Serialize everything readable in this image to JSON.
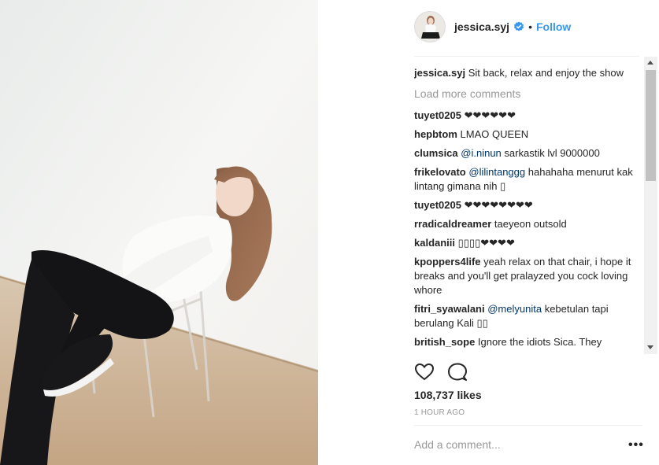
{
  "header": {
    "username": "jessica.syj",
    "separator": "•",
    "follow_label": "Follow"
  },
  "caption": {
    "user": "jessica.syj",
    "text": "Sit back, relax and enjoy the show"
  },
  "load_more": "Load more comments",
  "comments": [
    {
      "user": "tuyet0205",
      "text": "❤❤❤❤❤❤"
    },
    {
      "user": "hepbtom",
      "text": "LMAO QUEEN"
    },
    {
      "user": "clumsica",
      "mention": "@i.ninun",
      "text": "sarkastik lvl 9000000"
    },
    {
      "user": "frikelovato",
      "mention": "@lilintanggg",
      "text": "hahahaha menurut kak lintang gimana nih ▯"
    },
    {
      "user": "tuyet0205",
      "text": "❤❤❤❤❤❤❤❤"
    },
    {
      "user": "rradicaldreamer",
      "text": "taeyeon outsold"
    },
    {
      "user": "kaldaniii",
      "text": "▯▯▯▯❤❤❤❤"
    },
    {
      "user": "kpoppers4life",
      "text": "yeah relax on that chair, i hope it breaks and you'll get pralayzed you cock loving whore"
    },
    {
      "user": "fitri_syawalani",
      "mention": "@melyunita",
      "text": "kebetulan tapi berulang Kali ▯▯"
    },
    {
      "user": "british_sope",
      "text": "Ignore the idiots Sica. They"
    }
  ],
  "likes": "108,737 likes",
  "time": "1 HOUR AGO",
  "add_comment": {
    "placeholder": "Add a comment..."
  },
  "more_label": "•••",
  "icons": {
    "like": "heart-outline-icon",
    "comment": "speech-bubble-icon",
    "verified": "blue-check-badge-icon"
  },
  "colors": {
    "follow": "#3897f0",
    "mention": "#003569",
    "muted": "#999999",
    "text": "#262626"
  }
}
